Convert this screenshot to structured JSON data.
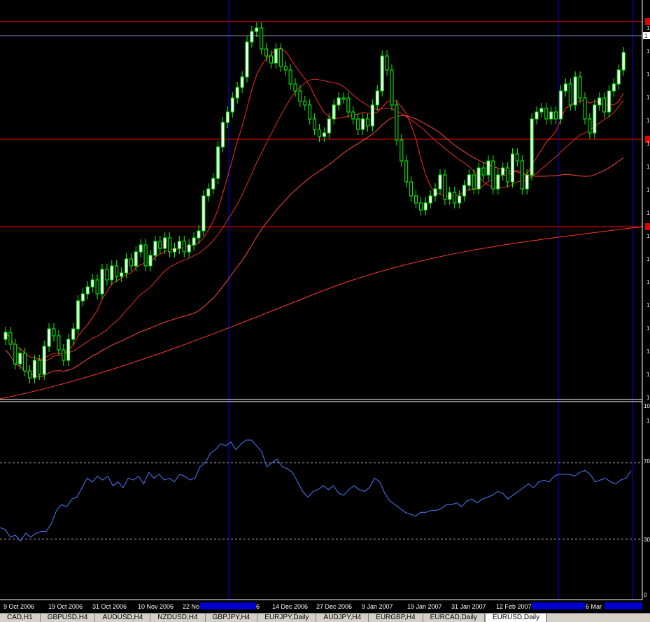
{
  "chart_data": [
    {
      "type": "candlestick",
      "symbol": "",
      "x_tick_labels": [
        "9 Oct 2006",
        "19 Oct 2006",
        "31 Oct 2006",
        "10 Nov 2006",
        "22 No",
        "6",
        "14 Dec 2006",
        "27 Dec 2006",
        "9 Jan 2007",
        "19 Jan 2007",
        "31 Jan 2007",
        "12 Feb 2007",
        "6 Mar"
      ],
      "price_axis_labels": [
        "1",
        "1",
        "1",
        "1",
        "1",
        "1",
        "1",
        "1",
        "1",
        "1",
        "1",
        "1",
        "1",
        "1",
        "1",
        "1",
        "1",
        "1"
      ],
      "current_price_label": "1",
      "horizontal_levels_color": "#ff0000",
      "bullish_color": "#00ff00",
      "moving_average_color": "#ff3b2f",
      "vertical_separators_color": "#0000ff",
      "grid": false
    },
    {
      "type": "line",
      "indicator": "RSI",
      "levels": [
        70,
        30
      ],
      "axis_labels": [
        "10",
        "70",
        "30",
        "0"
      ],
      "ylim": [
        0,
        100
      ],
      "series_color": "#4a7cff",
      "values": [
        36,
        35,
        31,
        32,
        29,
        33,
        31,
        33,
        34,
        34,
        38,
        45,
        48,
        47,
        51,
        52,
        57,
        62,
        60,
        63,
        61,
        63,
        58,
        60,
        57,
        62,
        61,
        63,
        59,
        65,
        62,
        64,
        61,
        62,
        60,
        64,
        63,
        61,
        62,
        68,
        70,
        75,
        77,
        80,
        79,
        81,
        77,
        80,
        82,
        82,
        79,
        76,
        68,
        70,
        72,
        68,
        67,
        65,
        60,
        55,
        52,
        55,
        56,
        58,
        56,
        58,
        54,
        53,
        56,
        58,
        56,
        55,
        57,
        62,
        60,
        54,
        50,
        48,
        46,
        44,
        43,
        42,
        44,
        44,
        45,
        45,
        46,
        48,
        48,
        49,
        47,
        50,
        51,
        49,
        51,
        52,
        53,
        55,
        54,
        51,
        53,
        55,
        57,
        59,
        57,
        60,
        61,
        60,
        63,
        64,
        64,
        64,
        63,
        65,
        66,
        64,
        60,
        61,
        62,
        60,
        59,
        61,
        62,
        66
      ]
    }
  ],
  "tabs": [
    {
      "label": "CAD,H1",
      "active": false
    },
    {
      "label": "GBPUSD,H4",
      "active": false
    },
    {
      "label": "AUDUSD,H4",
      "active": false
    },
    {
      "label": "NZDUSD,H4",
      "active": false
    },
    {
      "label": "GBPJPY,H4",
      "active": false
    },
    {
      "label": "EURJPY,Daily",
      "active": false
    },
    {
      "label": "AUDJPY,H4",
      "active": false
    },
    {
      "label": "EURGBP,H4",
      "active": false
    },
    {
      "label": "EURCAD,Daily",
      "active": false
    },
    {
      "label": "EURUSD,Daily",
      "active": true
    }
  ]
}
